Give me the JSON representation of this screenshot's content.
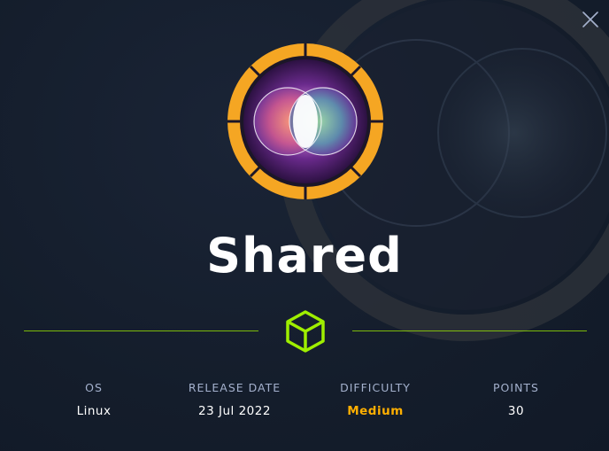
{
  "machine": {
    "name": "Shared",
    "logo_icon": "shared-logo-icon"
  },
  "dialog": {
    "close_icon": "close-icon",
    "divider_icon": "cube-icon"
  },
  "stats": [
    {
      "label": "OS",
      "value": "Linux"
    },
    {
      "label": "RELEASE DATE",
      "value": "23 Jul 2022"
    },
    {
      "label": "DIFFICULTY",
      "value": "Medium"
    },
    {
      "label": "POINTS",
      "value": "30"
    }
  ],
  "colors": {
    "background": "#141d2b",
    "accent": "#9fef00",
    "difficulty_medium": "#ffaf00",
    "logo_ring": "#f5a623",
    "label": "#a4b1cd"
  }
}
